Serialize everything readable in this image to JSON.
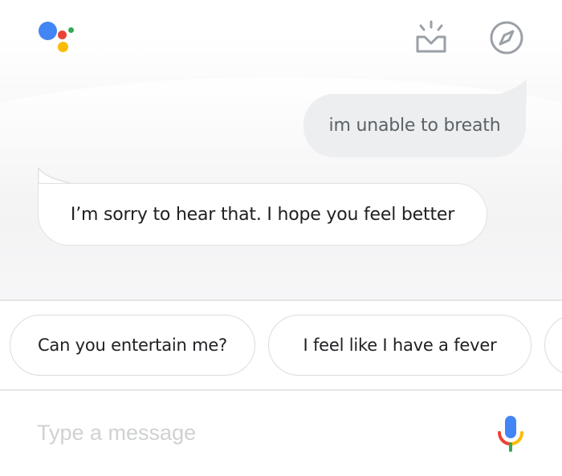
{
  "header": {
    "logo_icon": "google-assistant-logo-icon",
    "updates_icon": "updates-tray-icon",
    "explore_icon": "explore-compass-icon"
  },
  "conversation": {
    "user_message": "im unable to breath",
    "assistant_message": "I’m sorry to hear that. I hope you feel better"
  },
  "suggestions": [
    {
      "label": "Can you entertain me?"
    },
    {
      "label": "I feel like I have a fever"
    },
    {
      "label": ""
    }
  ],
  "composer": {
    "placeholder": "Type a message",
    "value": "",
    "mic_icon": "microphone-icon"
  },
  "colors": {
    "google_blue": "#4285F4",
    "google_red": "#EA4335",
    "google_yellow": "#FBBC05",
    "google_green": "#34A853",
    "icon_gray": "#9aa0a6",
    "user_bubble": "#eceef0"
  }
}
